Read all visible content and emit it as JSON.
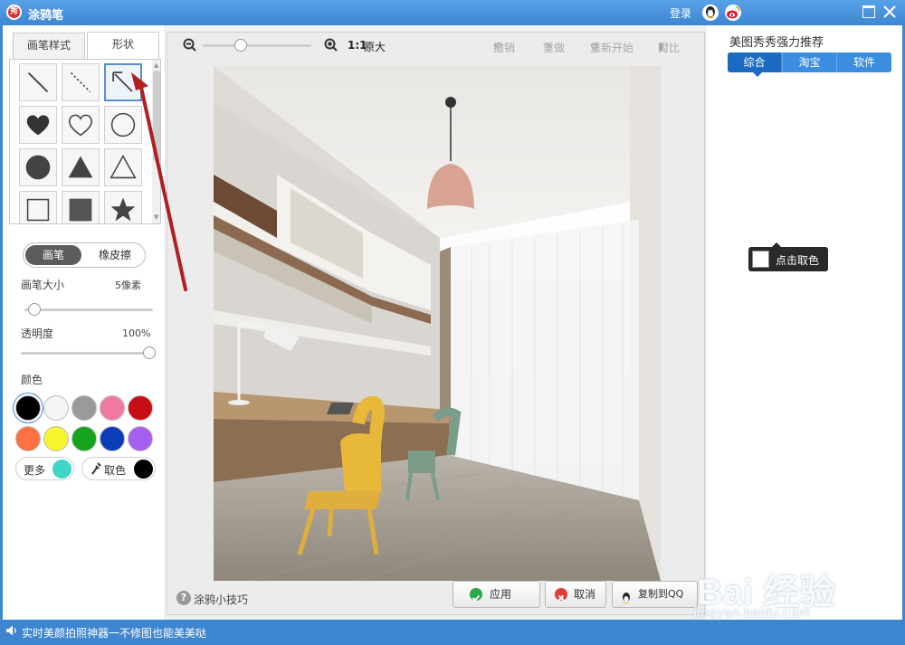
{
  "window": {
    "title": "涂鸦笔",
    "logo_text": "秀",
    "login_label": "登录"
  },
  "left_panel": {
    "tabs": [
      {
        "label": "画笔样式",
        "active": false
      },
      {
        "label": "形状",
        "active": true
      }
    ],
    "shapes": [
      {
        "name": "line",
        "selected": false
      },
      {
        "name": "dashed-line",
        "selected": false
      },
      {
        "name": "arrow",
        "selected": true
      },
      {
        "name": "filled-heart",
        "selected": false
      },
      {
        "name": "outline-heart",
        "selected": false
      },
      {
        "name": "outline-circle",
        "selected": false
      },
      {
        "name": "filled-circle",
        "selected": false
      },
      {
        "name": "filled-triangle",
        "selected": false
      },
      {
        "name": "outline-triangle",
        "selected": false
      },
      {
        "name": "outline-square",
        "selected": false
      },
      {
        "name": "filled-square",
        "selected": false
      },
      {
        "name": "filled-star",
        "selected": false
      }
    ],
    "mode": {
      "brush_label": "画笔",
      "eraser_label": "橡皮擦",
      "active": "brush"
    },
    "brush_size": {
      "label": "画笔大小",
      "value_text": "5像素",
      "level": 0.08
    },
    "opacity": {
      "label": "透明度",
      "value_text": "100%",
      "level": 1.0
    },
    "colors": {
      "label": "颜色",
      "swatches": [
        "#000000",
        "#f4f4f4",
        "#9a9a9a",
        "#f07aa0",
        "#c80e14",
        "#ff7043",
        "#f5f530",
        "#16a41c",
        "#0c3db8",
        "#a65ef0"
      ],
      "selected": "#000000",
      "more_label": "更多",
      "more_color": "#3fd6c8",
      "picker_label": "取色",
      "picker_color": "#000000"
    }
  },
  "canvas": {
    "zoom_level": 0.35,
    "zoom_reset_label": "1:1",
    "original_size_label": "原大",
    "actions": {
      "undo": "撤销",
      "redo": "重做",
      "restart": "重新开始",
      "compare": "对比"
    },
    "tips_label": "涂鸦小技巧",
    "buttons": {
      "apply": "应用",
      "cancel": "取消",
      "copy_qq": "复制到QQ"
    }
  },
  "right_panel": {
    "title": "美图秀秀强力推荐",
    "tabs": [
      {
        "label": "综合",
        "active": true
      },
      {
        "label": "淘宝",
        "active": false
      },
      {
        "label": "软件",
        "active": false
      }
    ],
    "tooltip": "点击取色"
  },
  "statusbar": {
    "text": "实时美颜拍照神器一不修图也能美美哒"
  },
  "watermark": {
    "brand": "Bai 经验",
    "url": "jingyan.baidu.com"
  }
}
